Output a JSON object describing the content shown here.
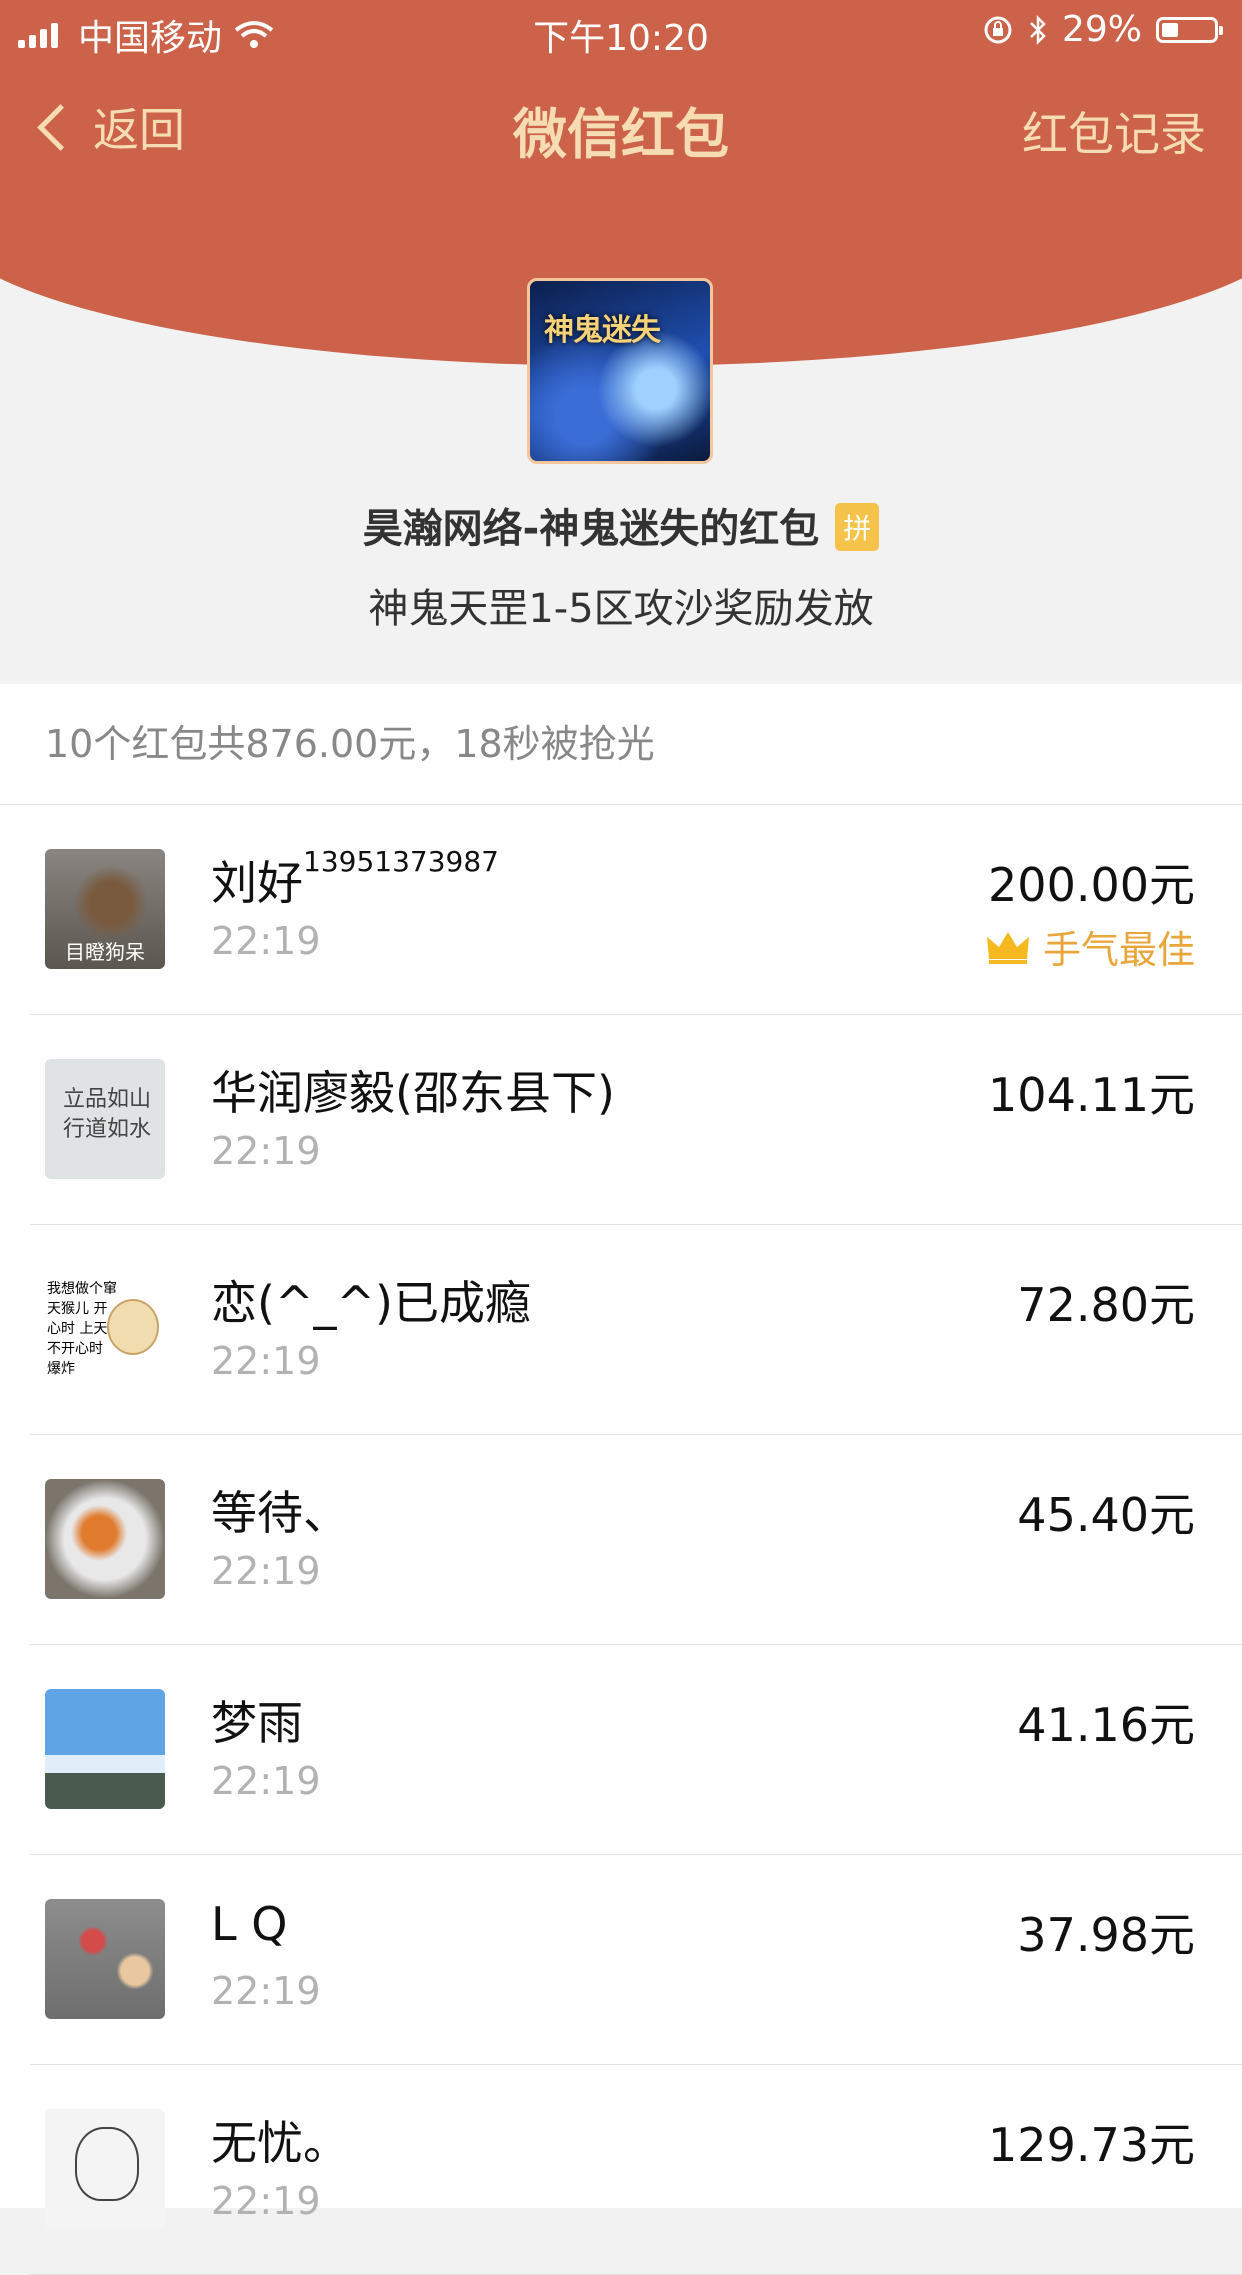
{
  "status_bar": {
    "carrier": "中国移动",
    "time": "下午10:20",
    "battery": "29%"
  },
  "nav": {
    "back_label": "返回",
    "title": "微信红包",
    "records_label": "红包记录"
  },
  "sender": {
    "avatar_text": "神鬼迷失",
    "title": "昊瀚网络-神鬼迷失的红包",
    "badge": "拼",
    "blessing": "神鬼天罡1-5区攻沙奖励发放"
  },
  "summary": "10个红包共876.00元，18秒被抢光",
  "rows": [
    {
      "name": "刘好",
      "name_sup": "13951373987",
      "time": "22:19",
      "amount": "200.00元",
      "best": "手气最佳",
      "avatar_caption": "目瞪狗呆"
    },
    {
      "name": "华润廖毅(邵东县下)",
      "time": "22:19",
      "amount": "104.11元",
      "avatar_caption": "立品如山\n行道如水"
    },
    {
      "name": "恋(^_^)已成瘾",
      "time": "22:19",
      "amount": "72.80元",
      "avatar_caption": "我想做个窜天猴儿 开心时 上天 不开心时 爆炸"
    },
    {
      "name": "等待、",
      "time": "22:19",
      "amount": "45.40元"
    },
    {
      "name": "梦雨",
      "time": "22:19",
      "amount": "41.16元"
    },
    {
      "name": "L Q",
      "time": "22:19",
      "amount": "37.98元"
    },
    {
      "name": "无忧。",
      "time": "22:19",
      "amount": "129.73元"
    }
  ],
  "colors": {
    "header_red": "#cc6249",
    "header_text_gold": "#f6dcb3",
    "best_luck_orange": "#e8a63c"
  }
}
